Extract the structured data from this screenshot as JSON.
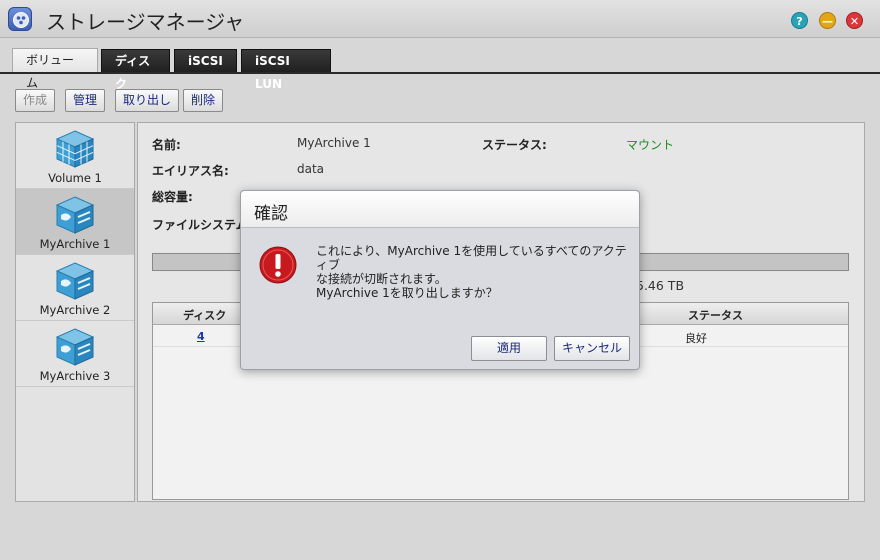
{
  "window": {
    "title": "ストレージマネージャ",
    "help_glyph": "?",
    "min_glyph": "—",
    "close_glyph": "✕"
  },
  "tabs": [
    {
      "label": "ボリューム",
      "active": true
    },
    {
      "label": "ディスク",
      "active": false
    },
    {
      "label": "iSCSI",
      "active": false
    },
    {
      "label": "iSCSI LUN",
      "active": false
    }
  ],
  "toolbar": {
    "create_label": "作成",
    "manage_label": "管理",
    "eject_label": "取り出し",
    "delete_label": "削除"
  },
  "volumes": [
    {
      "label": "Volume 1",
      "icon": "cube-icon",
      "selected": false
    },
    {
      "label": "MyArchive 1",
      "icon": "archive-icon",
      "selected": true
    },
    {
      "label": "MyArchive 2",
      "icon": "archive-icon",
      "selected": false
    },
    {
      "label": "MyArchive 3",
      "icon": "archive-icon",
      "selected": false
    }
  ],
  "detail": {
    "name_label": "名前:",
    "name_value": "MyArchive 1",
    "status_label": "ステータス:",
    "status_value": "マウント",
    "alias_label": "エイリアス名:",
    "alias_value": "data",
    "capacity_label": "総容量:",
    "fs_label": "ファイルシステム",
    "size_fragment": "5.46 TB"
  },
  "disk_table": {
    "col_disk": "ディスク",
    "col_status": "ステータス",
    "rows": [
      {
        "disk": "4",
        "status": "良好"
      }
    ]
  },
  "modal": {
    "title": "確認",
    "message_line1": "これにより、MyArchive 1を使用しているすべてのアクティブ",
    "message_line2": "な接続が切断されます。",
    "message_line3": "MyArchive 1を取り出しますか？",
    "apply_label": "適用",
    "cancel_label": "キャンセル"
  },
  "colors": {
    "status_green": "#1e8a1e",
    "warning_red": "#c8191e",
    "link_blue": "#1a3ab0"
  }
}
